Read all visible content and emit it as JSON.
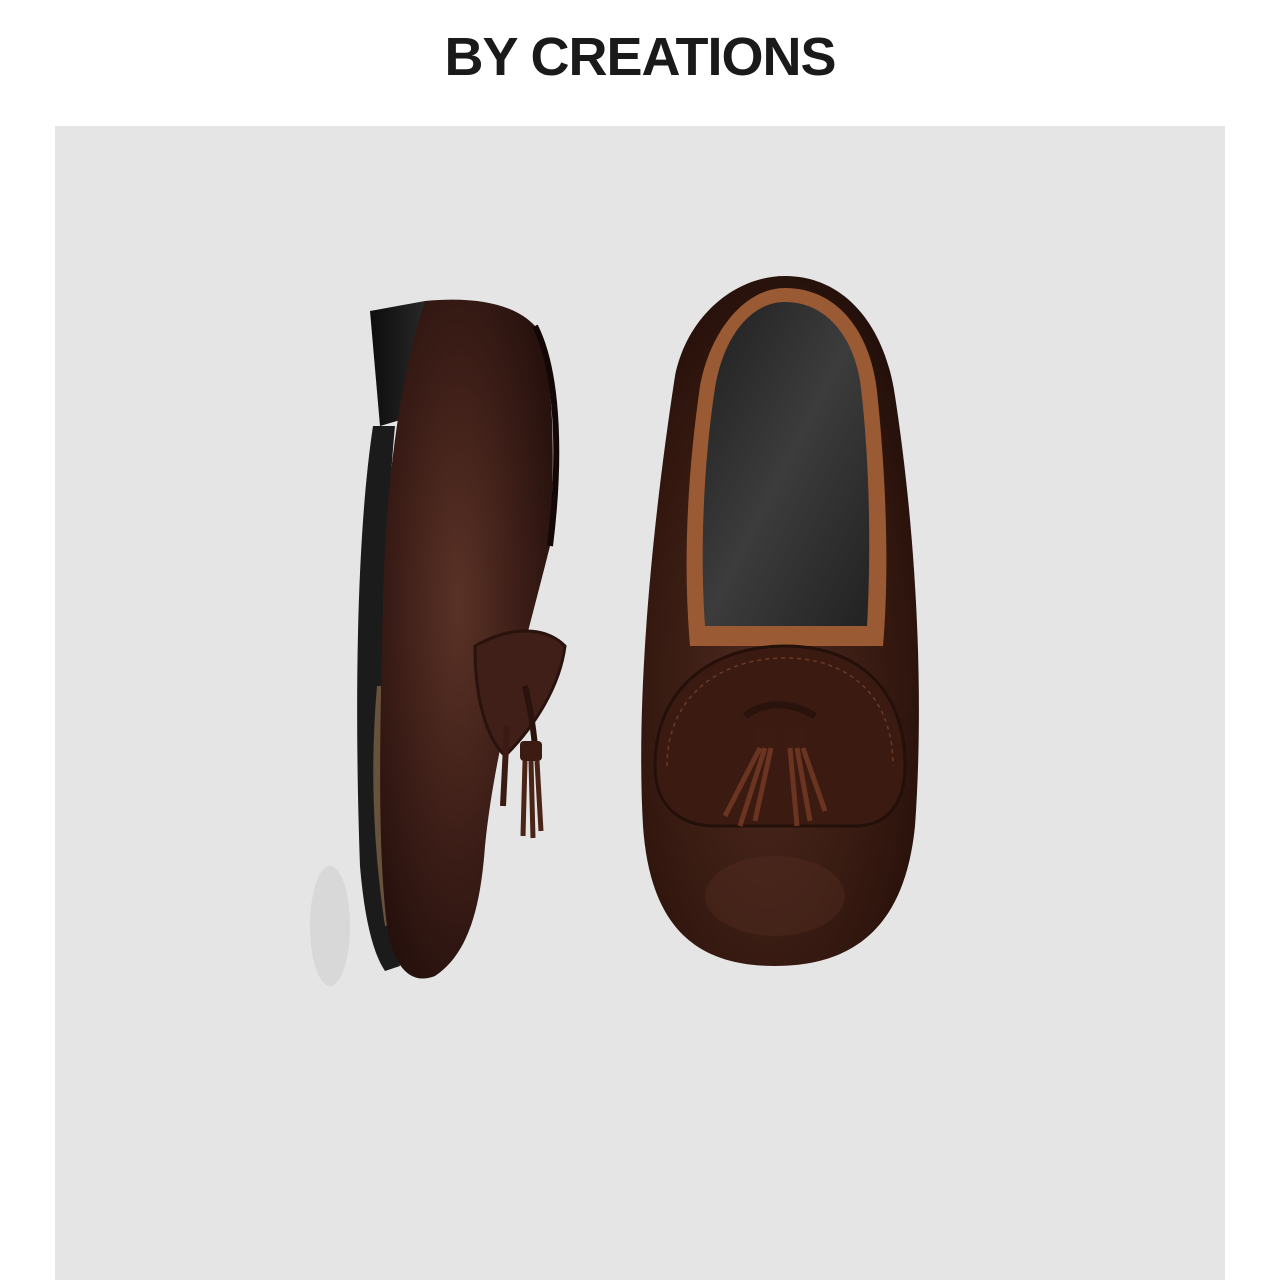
{
  "header": {
    "brand": "BY CREATIONS"
  },
  "product_photo": {
    "background_color": "#e5e5e6",
    "leather_color": "#3a1c16",
    "lining_color": "#9a5a33",
    "insole_color": "#2b2b2b",
    "sole_color": "#1a1a1a"
  }
}
